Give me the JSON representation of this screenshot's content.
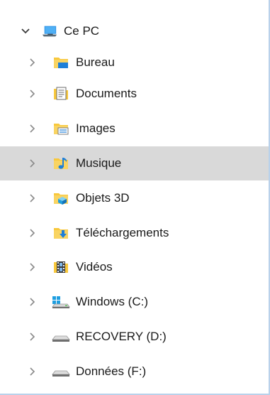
{
  "nav_tree": {
    "root": {
      "label": "Ce PC",
      "icon": "computer-icon",
      "expanded": true
    },
    "items": [
      {
        "label": "Bureau",
        "icon": "desktop-folder-icon"
      },
      {
        "label": "Documents",
        "icon": "documents-folder-icon"
      },
      {
        "label": "Images",
        "icon": "pictures-folder-icon"
      },
      {
        "label": "Musique",
        "icon": "music-folder-icon",
        "selected": true
      },
      {
        "label": "Objets 3D",
        "icon": "3d-objects-folder-icon"
      },
      {
        "label": "Téléchargements",
        "icon": "downloads-folder-icon"
      },
      {
        "label": "Vidéos",
        "icon": "videos-folder-icon"
      },
      {
        "label": "Windows (C:)",
        "icon": "windows-drive-icon"
      },
      {
        "label": "RECOVERY (D:)",
        "icon": "drive-icon"
      },
      {
        "label": "Données (F:)",
        "icon": "drive-icon"
      }
    ]
  },
  "colors": {
    "selection_bg": "#d9d9d9",
    "folder_yellow": "#f8c83c",
    "accent_blue": "#1e7fd8",
    "pane_border": "#b9d1ea"
  }
}
